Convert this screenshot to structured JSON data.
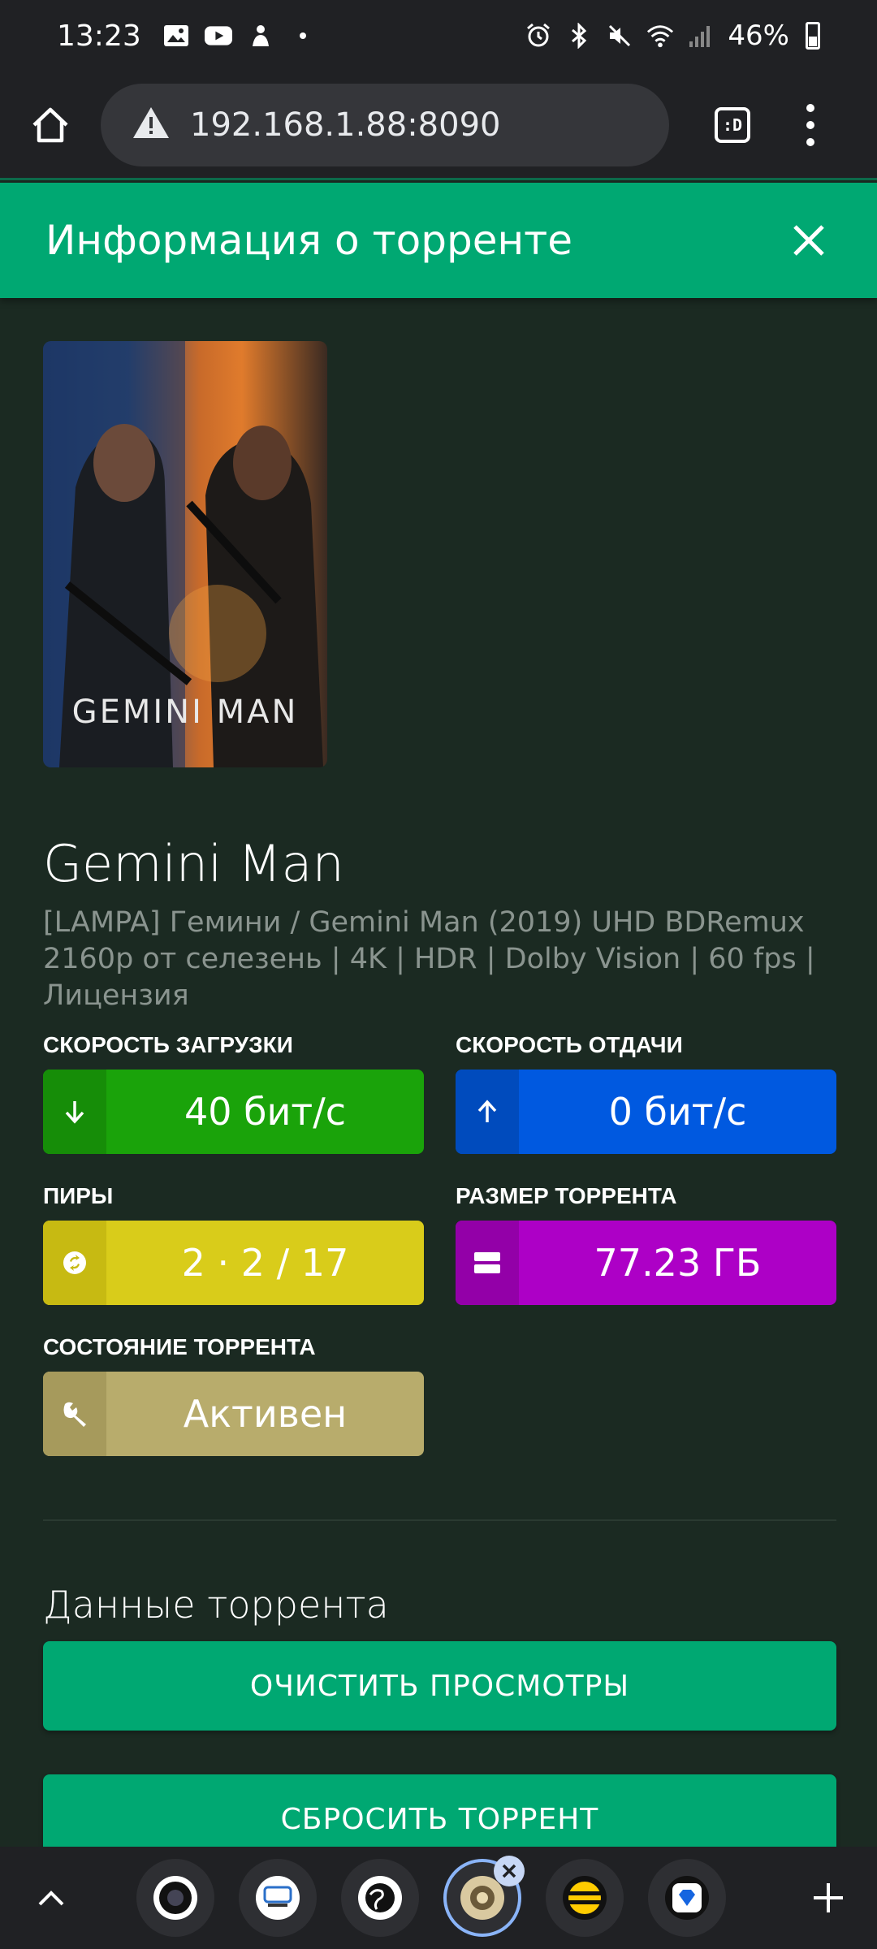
{
  "status_bar": {
    "time": "13:23",
    "battery": "46%"
  },
  "browser": {
    "url": "192.168.1.88:8090",
    "tab_label": ":D"
  },
  "dialog": {
    "title": "Информация о торренте"
  },
  "torrent": {
    "poster_caption": "GEMINI MAN",
    "title": "Gemini Man",
    "description": "[LAMPA] Гемини / Gemini Man (2019) UHD BDRemux 2160p от селезень | 4K | HDR | Dolby Vision | 60 fps | Лицензия"
  },
  "stats": {
    "download": {
      "label": "Скорость загрузки",
      "value": "40 бит/с",
      "color": "#1aa30a",
      "icon_color": "#168d08"
    },
    "upload": {
      "label": "Скорость отдачи",
      "value": "0 бит/с",
      "color": "#0059e0",
      "icon_color": "#004bbd"
    },
    "peers": {
      "label": "Пиры",
      "value": "2 · 2 / 17",
      "color": "#d9cc1a",
      "icon_color": "#c7ba12"
    },
    "size": {
      "label": "Размер торрента",
      "value": "77.23 ГБ",
      "color": "#ad00c6",
      "icon_color": "#9300a8"
    },
    "state": {
      "label": "Состояние торрента",
      "value": "Активен",
      "color": "#b8ac6c",
      "icon_color": "#a69a5c"
    }
  },
  "data_section": {
    "title": "Данные торрента",
    "clear_button": "Очистить просмотры",
    "reset_button": "Сбросить торрент"
  },
  "tab_strip": {
    "tabs": [
      "camera-favicon",
      "logic-favicon",
      "globe-favicon",
      "torrserver-favicon",
      "beeline-favicon",
      "diamond-favicon"
    ]
  }
}
